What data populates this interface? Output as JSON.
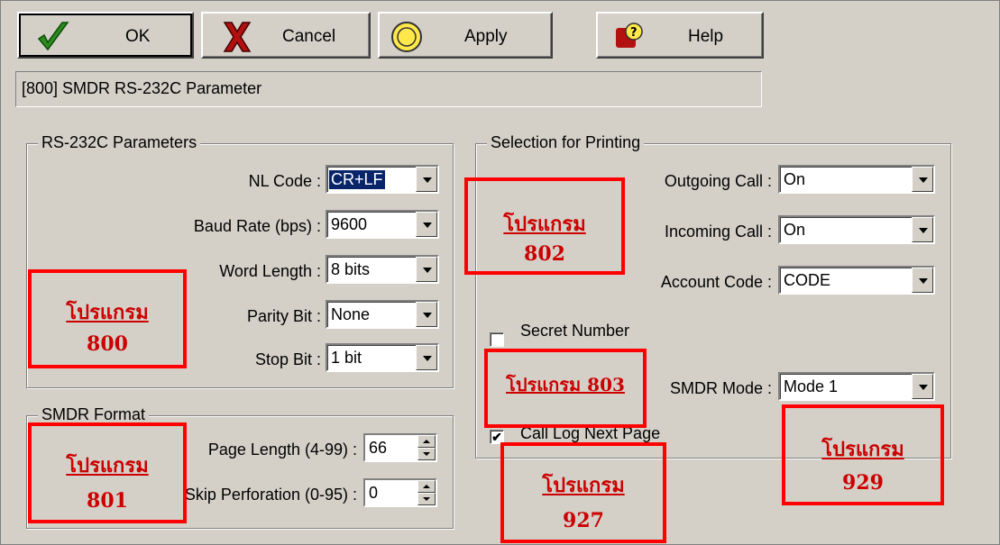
{
  "toolbar": {
    "ok_label": "OK",
    "cancel_label": "Cancel",
    "apply_label": "Apply",
    "help_label": "Help",
    "ok_icon": "checkmark-icon",
    "cancel_icon": "x-icon",
    "apply_icon": "apply-circle-icon",
    "help_icon": "help-icon"
  },
  "title": "[800] SMDR RS-232C Parameter",
  "rs232": {
    "group_title": "RS-232C Parameters",
    "nl_code": {
      "label": "NL Code :",
      "value": "CR+LF"
    },
    "baud_rate": {
      "label": "Baud Rate (bps) :",
      "value": "9600"
    },
    "word_length": {
      "label": "Word Length :",
      "value": "8 bits"
    },
    "parity_bit": {
      "label": "Parity Bit :",
      "value": "None"
    },
    "stop_bit": {
      "label": "Stop Bit :",
      "value": "1 bit"
    }
  },
  "smdr_format": {
    "group_title": "SMDR Format",
    "page_length": {
      "label": "Page Length (4-99) :",
      "value": "66"
    },
    "skip_perforation": {
      "label": "Skip Perforation (0-95) :",
      "value": "0"
    }
  },
  "printing": {
    "group_title": "Selection for Printing",
    "outgoing_call": {
      "label": "Outgoing Call :",
      "value": "On"
    },
    "incoming_call": {
      "label": "Incoming Call :",
      "value": "On"
    },
    "account_code": {
      "label": "Account Code :",
      "value": "CODE"
    },
    "secret_number": {
      "label": "Secret Number",
      "checked": false
    },
    "smdr_mode": {
      "label": "SMDR Mode :",
      "value": "Mode 1"
    },
    "call_log_next_page": {
      "label": "Call Log Next Page",
      "checked": true,
      "mark": "✔"
    }
  },
  "annotations": {
    "a800": {
      "line1": "โปรแกรม",
      "line2": "800"
    },
    "a801": {
      "line1": "โปรแกรม",
      "line2": "801"
    },
    "a802": {
      "line1": "โปรแกรม",
      "line2": "802"
    },
    "a803": {
      "line1": "โปรแกรม 803"
    },
    "a927": {
      "line1": "โปรแกรม",
      "line2": "927"
    },
    "a929": {
      "line1": "โปรแกรม",
      "line2": "929"
    }
  },
  "colors": {
    "dialog_bg": "#d4d0c8",
    "selection": "#0a246a",
    "annotation": "#ff0000"
  }
}
